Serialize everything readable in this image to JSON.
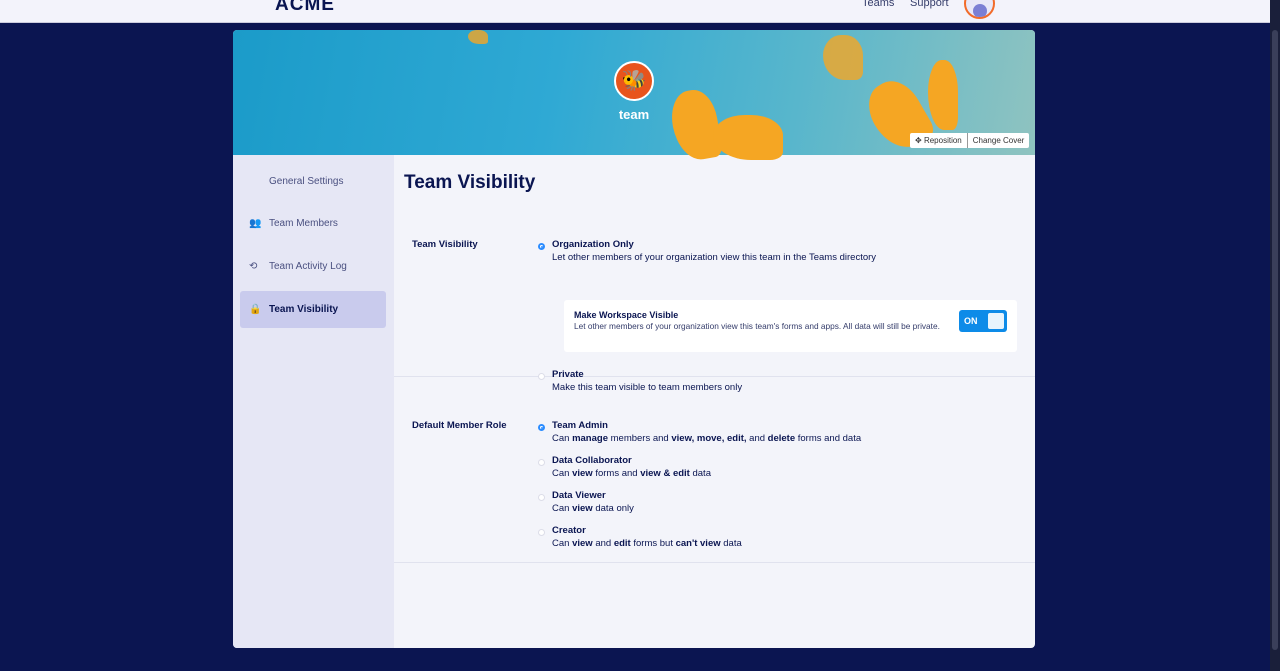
{
  "topbar": {
    "logo": "ACME",
    "nav": [
      "Teams",
      "Support"
    ]
  },
  "banner": {
    "team_name": "team",
    "reposition": "Reposition",
    "change_cover": "Change Cover"
  },
  "sidebar": {
    "items": [
      {
        "label": "General Settings",
        "icon": ""
      },
      {
        "label": "Team Members",
        "icon": "users-icon"
      },
      {
        "label": "Team Activity Log",
        "icon": "history-icon"
      },
      {
        "label": "Team Visibility",
        "icon": "lock-icon",
        "active": true
      }
    ]
  },
  "main": {
    "title": "Team Visibility",
    "visibility": {
      "label": "Team Visibility",
      "options": [
        {
          "title": "Organization Only",
          "desc": "Let other members of your organization view this team in the Teams directory",
          "selected": true
        },
        {
          "title": "Private",
          "desc": "Make this team visible to team members only",
          "selected": false
        }
      ],
      "workspace": {
        "title": "Make Workspace Visible",
        "desc": "Let other members of your organization view this team's forms and apps. All data will still be private.",
        "toggle": "ON"
      }
    },
    "role": {
      "label": "Default Member Role",
      "options": [
        {
          "title": "Team Admin",
          "selected": true,
          "desc": [
            {
              "t": "Can "
            },
            {
              "t": "manage",
              "b": true
            },
            {
              "t": " members and "
            },
            {
              "t": "view, move, edit,",
              "b": true
            },
            {
              "t": " and "
            },
            {
              "t": "delete",
              "b": true
            },
            {
              "t": " forms and data"
            }
          ]
        },
        {
          "title": "Data Collaborator",
          "selected": false,
          "desc": [
            {
              "t": "Can "
            },
            {
              "t": "view",
              "b": true
            },
            {
              "t": " forms and "
            },
            {
              "t": "view & edit",
              "b": true
            },
            {
              "t": " data"
            }
          ]
        },
        {
          "title": "Data Viewer",
          "selected": false,
          "desc": [
            {
              "t": "Can "
            },
            {
              "t": "view",
              "b": true
            },
            {
              "t": " data only"
            }
          ]
        },
        {
          "title": "Creator",
          "selected": false,
          "desc": [
            {
              "t": "Can "
            },
            {
              "t": "view",
              "b": true
            },
            {
              "t": " and "
            },
            {
              "t": "edit",
              "b": true
            },
            {
              "t": " forms but "
            },
            {
              "t": "can't view",
              "b": true
            },
            {
              "t": " data"
            }
          ]
        }
      ]
    }
  }
}
